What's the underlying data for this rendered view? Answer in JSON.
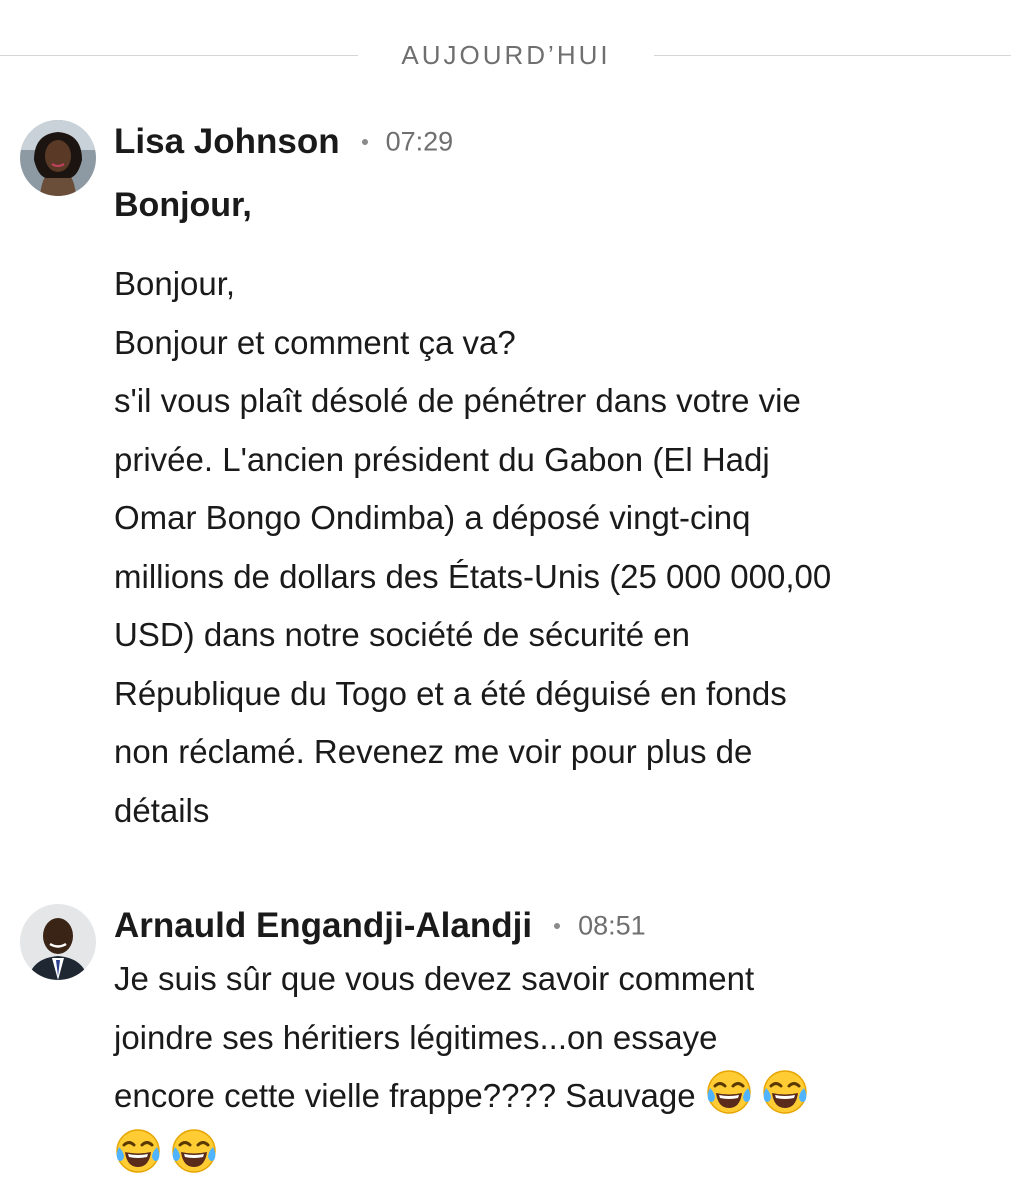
{
  "divider": {
    "label": "AUJOURD’HUI"
  },
  "messages": [
    {
      "author": "Lisa Johnson",
      "time": "07:29",
      "subject": "Bonjour,",
      "lines": [
        "Bonjour,",
        "Bonjour et comment ça va?",
        "s'il vous plaît désolé de pénétrer dans votre vie",
        "privée. L'ancien président du Gabon (El Hadj",
        "Omar Bongo Ondimba) a déposé vingt-cinq",
        "millions de dollars des États-Unis (25 000 000,00",
        "USD) dans notre société de sécurité en",
        "République du Togo et a été déguisé en fonds",
        "non réclamé. Revenez me voir pour plus de",
        "détails"
      ]
    },
    {
      "author": "Arnauld Engandji-Alandji",
      "time": "08:51",
      "lines": [
        "Je suis sûr que vous devez savoir comment",
        "joindre ses héritiers légitimes...on essaye",
        "encore cette vielle frappe???? Sauvage"
      ],
      "emojis": [
        "face-with-tears-of-joy",
        "face-with-tears-of-joy",
        "face-with-tears-of-joy",
        "face-with-tears-of-joy"
      ]
    }
  ]
}
